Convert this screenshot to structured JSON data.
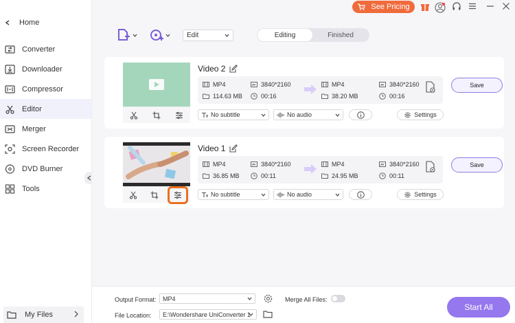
{
  "sidebar": {
    "home_label": "Home",
    "items": [
      {
        "label": "Converter",
        "icon": "converter-icon",
        "active": false
      },
      {
        "label": "Downloader",
        "icon": "downloader-icon",
        "active": false
      },
      {
        "label": "Compressor",
        "icon": "compressor-icon",
        "active": false
      },
      {
        "label": "Editor",
        "icon": "scissors-icon",
        "active": true
      },
      {
        "label": "Merger",
        "icon": "merger-icon",
        "active": false
      },
      {
        "label": "Screen Recorder",
        "icon": "screen-recorder-icon",
        "active": false
      },
      {
        "label": "DVD Burner",
        "icon": "disc-icon",
        "active": false
      },
      {
        "label": "Tools",
        "icon": "grid-icon",
        "active": false
      }
    ],
    "my_files_label": "My Files"
  },
  "topbar": {
    "pricing_label": "See Pricing",
    "accent": "#f06b3c"
  },
  "toolbar": {
    "edit_select_value": "Edit",
    "tabs": {
      "editing": "Editing",
      "finished": "Finished"
    }
  },
  "videos": [
    {
      "title": "Video 2",
      "src_format": "MP4",
      "src_resolution": "3840*2160",
      "src_size": "114.63 MB",
      "src_duration": "00:16",
      "out_format": "MP4",
      "out_resolution": "3840*2160",
      "out_size": "38.20 MB",
      "out_duration": "00:16",
      "subtitle": "No subtitle",
      "audio": "No audio",
      "settings_label": "Settings",
      "save_label": "Save"
    },
    {
      "title": "Video 1",
      "src_format": "MP4",
      "src_resolution": "3840*2160",
      "src_size": "36.85 MB",
      "src_duration": "00:11",
      "out_format": "MP4",
      "out_resolution": "3840*2160",
      "out_size": "24.95 MB",
      "out_duration": "00:11",
      "subtitle": "No subtitle",
      "audio": "No audio",
      "settings_label": "Settings",
      "save_label": "Save"
    }
  ],
  "bottom": {
    "output_format_label": "Output Format:",
    "output_format_value": "MP4",
    "merge_label": "Merge All Files:",
    "merge_on": false,
    "file_location_label": "File Location:",
    "file_location_value": "E:\\Wondershare UniConverter 1",
    "start_all_label": "Start All",
    "start_color": "#9577ee"
  }
}
